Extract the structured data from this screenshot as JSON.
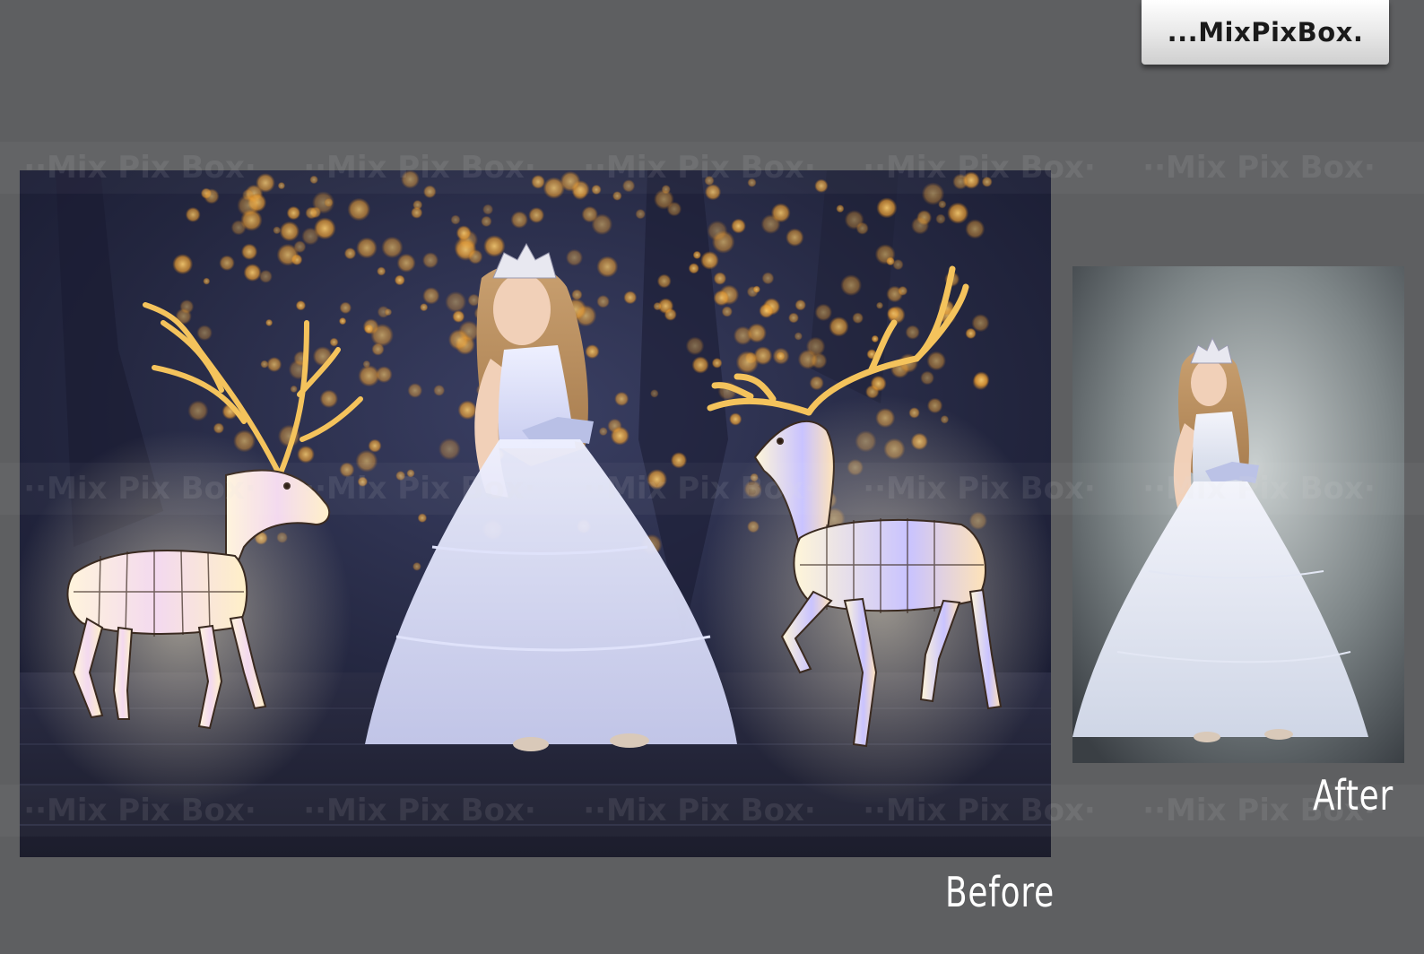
{
  "logo": {
    "text": "...MixPixBox."
  },
  "watermark": {
    "text": "··Mix Pix Box·",
    "repeats": 5
  },
  "before_photo": {
    "alt": "Girl in white ball gown with tiara between two glowing lantern deer, bokeh lights at night"
  },
  "after_photo": {
    "alt": "Girl in white ball gown with tiara on grey studio backdrop"
  },
  "captions": {
    "before": "Before",
    "after": "After"
  },
  "colors": {
    "page_background": "#5e5f61",
    "bokeh": "#f0b040",
    "caption": "#ffffff"
  }
}
